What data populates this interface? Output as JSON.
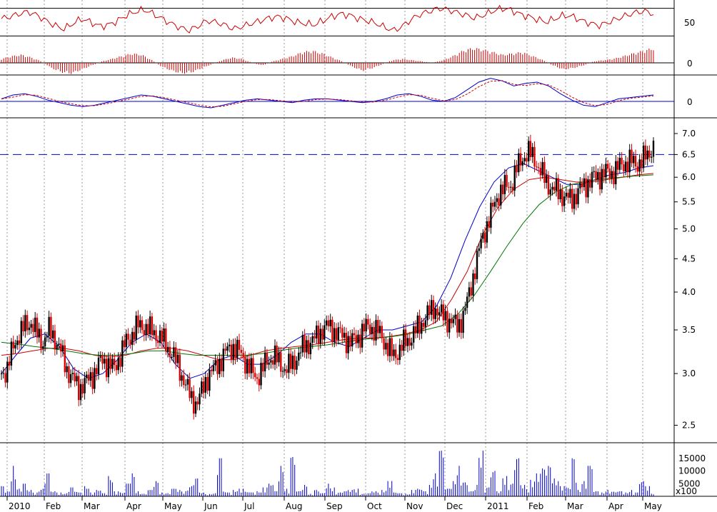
{
  "colors": {
    "background": "#ffffff",
    "frame": "#000000",
    "grid": "#9a9a9a",
    "up_candle": "#000000",
    "down_candle": "#dd0000",
    "rsi_line": "#cc0000",
    "histogram": "#cc0000",
    "osc_main": "#0000cc",
    "osc_signal": "#cc0000",
    "ma_short": "#0000cc",
    "ma_mid": "#cc0000",
    "ma_long": "#007700",
    "level_line": "#0000cc",
    "volume": "#0000cc"
  },
  "chart_data": [
    {
      "type": "line",
      "panel": "oscillator-rsi",
      "y_ticks": [
        "50"
      ],
      "reference_levels": [
        30,
        70
      ],
      "grid": "dotted vertical",
      "approx_values": [
        55,
        58,
        62,
        65,
        60,
        52,
        45,
        40,
        48,
        55,
        50,
        44,
        46,
        52,
        60,
        65,
        68,
        62,
        55,
        48,
        42,
        38,
        44,
        52,
        50,
        46,
        40,
        44,
        48,
        52,
        56,
        58,
        55,
        50,
        48,
        46,
        52,
        58,
        62,
        60,
        55,
        52,
        48,
        42,
        38,
        45,
        55,
        62,
        66,
        70,
        68,
        64,
        60,
        56,
        60,
        66,
        70,
        68,
        62,
        58,
        54,
        50,
        55,
        60,
        58,
        52,
        48,
        45,
        50,
        55,
        60,
        64,
        66,
        62
      ]
    },
    {
      "type": "bar",
      "panel": "histogram",
      "y_ticks": [
        "0"
      ],
      "approx_values": [
        0.3,
        0.5,
        0.6,
        0.4,
        0.1,
        -0.4,
        -0.7,
        -0.8,
        -0.5,
        -0.2,
        0.1,
        0.3,
        0.5,
        0.7,
        0.6,
        0.2,
        -0.3,
        -0.6,
        -0.8,
        -0.7,
        -0.4,
        -0.1,
        0.2,
        0.4,
        0.3,
        0.0,
        -0.2,
        0.1,
        0.3,
        0.5,
        0.8,
        0.9,
        0.7,
        0.4,
        0.1,
        -0.3,
        -0.6,
        -0.4,
        -0.1,
        0.2,
        0.3,
        0.2,
        0.1,
        0.0,
        0.2,
        0.5,
        0.9,
        1.1,
        1.0,
        0.8,
        0.6,
        0.7,
        0.8,
        0.5,
        0.2,
        -0.2,
        -0.5,
        -0.4,
        -0.2,
        0.1,
        0.2,
        0.3,
        0.5,
        0.7,
        0.9,
        1.1
      ]
    },
    {
      "type": "line",
      "panel": "oscillator",
      "y_ticks": [
        "0"
      ],
      "approx_values": [
        0.2,
        0.5,
        0.6,
        0.4,
        0.1,
        -0.1,
        -0.3,
        -0.4,
        -0.3,
        -0.1,
        0.1,
        0.3,
        0.5,
        0.4,
        0.2,
        0.0,
        -0.2,
        -0.4,
        -0.5,
        -0.3,
        -0.1,
        0.1,
        0.2,
        0.1,
        0.0,
        -0.1,
        0.1,
        0.2,
        0.2,
        0.1,
        0.0,
        -0.1,
        0.0,
        0.2,
        0.5,
        0.6,
        0.4,
        0.1,
        0.0,
        0.3,
        0.9,
        1.5,
        1.8,
        1.6,
        1.2,
        1.4,
        1.5,
        1.2,
        0.6,
        0.1,
        -0.3,
        -0.4,
        -0.1,
        0.2,
        0.3,
        0.4,
        0.5
      ]
    },
    {
      "type": "candlestick",
      "panel": "price",
      "scale": "log",
      "y_ticks": [
        "7.0",
        "6.5",
        "6.0",
        "5.5",
        "5.0",
        "4.5",
        "4.0",
        "3.5",
        "3.0",
        "2.5"
      ],
      "ylim": [
        2.35,
        7.4
      ],
      "x_ticks": [
        "2010",
        "Feb",
        "Mar",
        "Apr",
        "May",
        "Jun",
        "Jul",
        "Aug",
        "Sep",
        "Oct",
        "Nov",
        "Dec",
        "2011",
        "Feb",
        "Mar",
        "Apr",
        "May"
      ],
      "reference_level": 6.5,
      "approx_closes": [
        3.0,
        3.05,
        3.3,
        3.45,
        3.55,
        3.6,
        3.45,
        3.35,
        3.5,
        3.4,
        3.25,
        3.05,
        2.95,
        2.85,
        2.9,
        2.95,
        3.05,
        3.15,
        3.1,
        3.05,
        3.2,
        3.35,
        3.45,
        3.55,
        3.55,
        3.5,
        3.45,
        3.4,
        3.3,
        3.2,
        3.05,
        2.9,
        2.75,
        2.7,
        2.85,
        3.0,
        3.05,
        3.15,
        3.25,
        3.3,
        3.25,
        3.15,
        3.05,
        2.95,
        3.05,
        3.15,
        3.2,
        3.1,
        3.05,
        3.1,
        3.2,
        3.3,
        3.35,
        3.4,
        3.5,
        3.55,
        3.5,
        3.45,
        3.4,
        3.35,
        3.4,
        3.5,
        3.55,
        3.5,
        3.45,
        3.3,
        3.2,
        3.25,
        3.35,
        3.4,
        3.5,
        3.6,
        3.7,
        3.8,
        3.7,
        3.65,
        3.6,
        3.55,
        3.7,
        4.0,
        4.4,
        4.8,
        5.1,
        5.4,
        5.7,
        5.8,
        5.85,
        6.2,
        6.45,
        6.55,
        6.4,
        6.1,
        5.9,
        5.75,
        5.7,
        5.6,
        5.55,
        5.65,
        5.8,
        5.9,
        6.0,
        6.05,
        6.1,
        6.1,
        6.2,
        6.3,
        6.35,
        6.3,
        6.35,
        6.5,
        6.7
      ],
      "moving_averages": [
        {
          "approx_values": [
            3.0,
            3.2,
            3.4,
            3.45,
            3.3,
            3.05,
            2.95,
            3.0,
            3.15,
            3.35,
            3.45,
            3.35,
            3.1,
            2.95,
            3.0,
            3.15,
            3.2,
            3.1,
            3.1,
            3.2,
            3.35,
            3.45,
            3.45,
            3.35,
            3.3,
            3.4,
            3.5,
            3.5,
            3.55,
            3.6,
            3.8,
            4.2,
            4.8,
            5.4,
            5.9,
            6.2,
            6.3,
            6.15,
            6.0,
            5.85,
            5.85,
            5.95,
            6.05,
            6.1,
            6.2,
            6.25
          ]
        },
        {
          "approx_values": [
            3.2,
            3.22,
            3.25,
            3.28,
            3.28,
            3.25,
            3.2,
            3.18,
            3.2,
            3.25,
            3.28,
            3.28,
            3.25,
            3.2,
            3.15,
            3.15,
            3.2,
            3.25,
            3.28,
            3.3,
            3.32,
            3.35,
            3.38,
            3.4,
            3.4,
            3.42,
            3.45,
            3.5,
            3.6,
            3.9,
            4.3,
            4.9,
            5.4,
            5.75,
            5.95,
            6.0,
            5.95,
            5.9,
            5.9,
            5.95,
            6.0,
            6.05,
            6.08
          ]
        },
        {
          "approx_values": [
            3.35,
            3.33,
            3.3,
            3.28,
            3.25,
            3.22,
            3.2,
            3.2,
            3.22,
            3.25,
            3.25,
            3.22,
            3.2,
            3.2,
            3.2,
            3.2,
            3.22,
            3.25,
            3.28,
            3.3,
            3.32,
            3.35,
            3.38,
            3.4,
            3.42,
            3.45,
            3.5,
            3.55,
            3.7,
            3.95,
            4.3,
            4.7,
            5.1,
            5.45,
            5.7,
            5.85,
            5.92,
            5.97,
            6.0,
            6.03,
            6.05
          ]
        }
      ]
    },
    {
      "type": "bar",
      "panel": "volume",
      "y_ticks": [
        "15000",
        "10000",
        "5000"
      ],
      "multiplier_label": "x100",
      "ylim": [
        0,
        20000
      ],
      "approx_values": [
        4000,
        2000,
        12000,
        3000,
        5000,
        2500,
        1500,
        3000,
        9000,
        2000,
        1500,
        1200,
        3500,
        2000,
        1500,
        4000,
        1500,
        2500,
        1200,
        8000,
        2000,
        1500,
        5000,
        9000,
        2000,
        1000,
        2500,
        6000,
        1500,
        1200,
        3000,
        2500,
        2000,
        4000,
        7000,
        1500,
        900,
        1200,
        15000,
        2000,
        1500,
        2500,
        3000,
        1800,
        1500,
        2000,
        3500,
        5000,
        2000,
        12000,
        3000,
        15500,
        2000,
        4500,
        1000,
        2500,
        1200,
        5000,
        3500,
        1500,
        2000,
        2500,
        3000,
        1000,
        1200,
        2000,
        1500,
        2500,
        6000,
        1500,
        1200,
        1000,
        2500,
        3000,
        2000,
        4500,
        9000,
        18000,
        3000,
        6000,
        12000,
        5500,
        2000,
        4500,
        18000,
        3500,
        10000,
        2000,
        8000,
        5000,
        15000,
        4500,
        3000,
        6500,
        9000,
        11000,
        12000,
        7000,
        4000,
        3500,
        15000,
        2500,
        6000,
        12000,
        2000,
        1500,
        2500,
        1800,
        2000,
        1500,
        2500,
        1500,
        6000,
        4000,
        1200
      ]
    }
  ]
}
